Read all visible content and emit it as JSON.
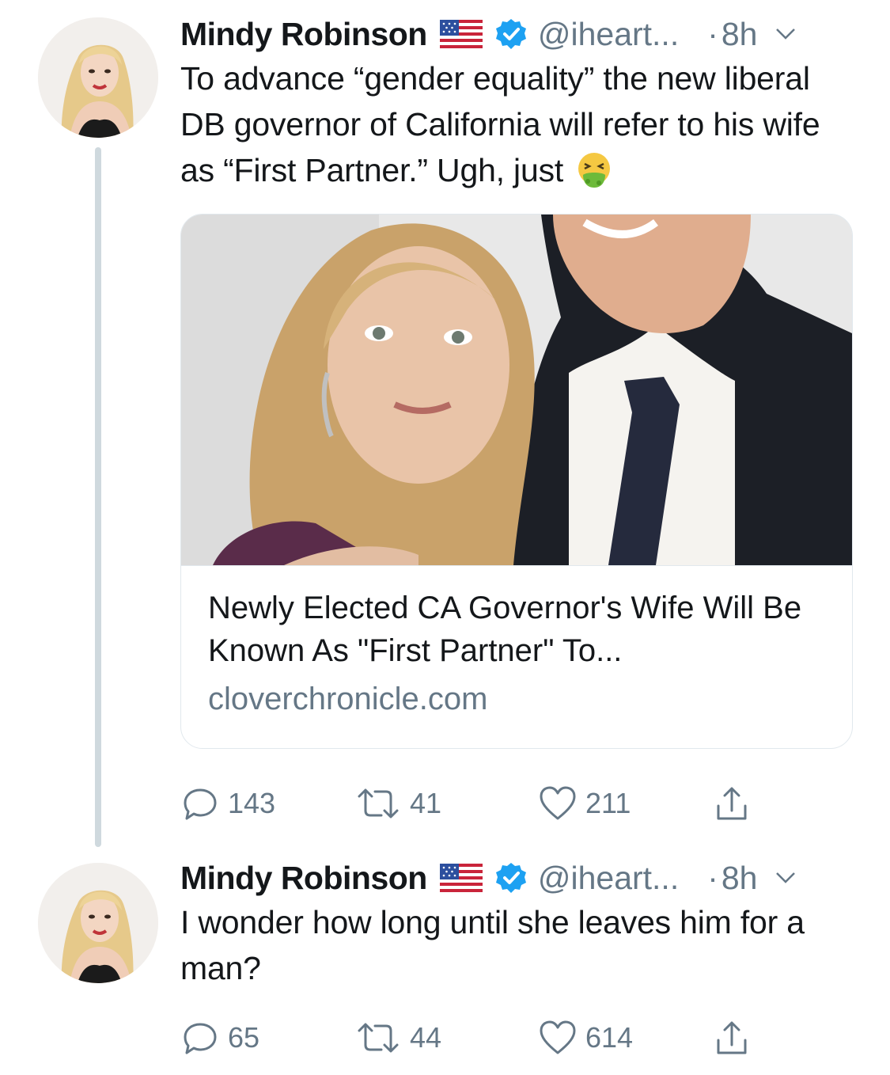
{
  "tweets": [
    {
      "author": {
        "name": "Mindy Robinson",
        "handle": "@iheart...",
        "time": "8h",
        "dot": "·"
      },
      "text": "To advance “gender equality” the new liberal DB governor of California will refer to his wife as “First Partner.” Ugh, just",
      "emoji_icon": "nauseated-face-icon",
      "card": {
        "title": "Newly Elected CA Governor's Wife Will Be Known As \"First Partner\" To...",
        "domain": "cloverchronicle.com"
      },
      "stats": {
        "replies": "143",
        "retweets": "41",
        "likes": "211"
      }
    },
    {
      "author": {
        "name": "Mindy Robinson",
        "handle": "@iheart...",
        "time": "8h",
        "dot": "·"
      },
      "text": "I wonder how long until she leaves him for a man?",
      "stats": {
        "replies": "65",
        "retweets": "44",
        "likes": "614"
      }
    }
  ],
  "colors": {
    "accent": "#1da1f2",
    "muted": "#657786",
    "thread_line": "#cfd9de"
  }
}
